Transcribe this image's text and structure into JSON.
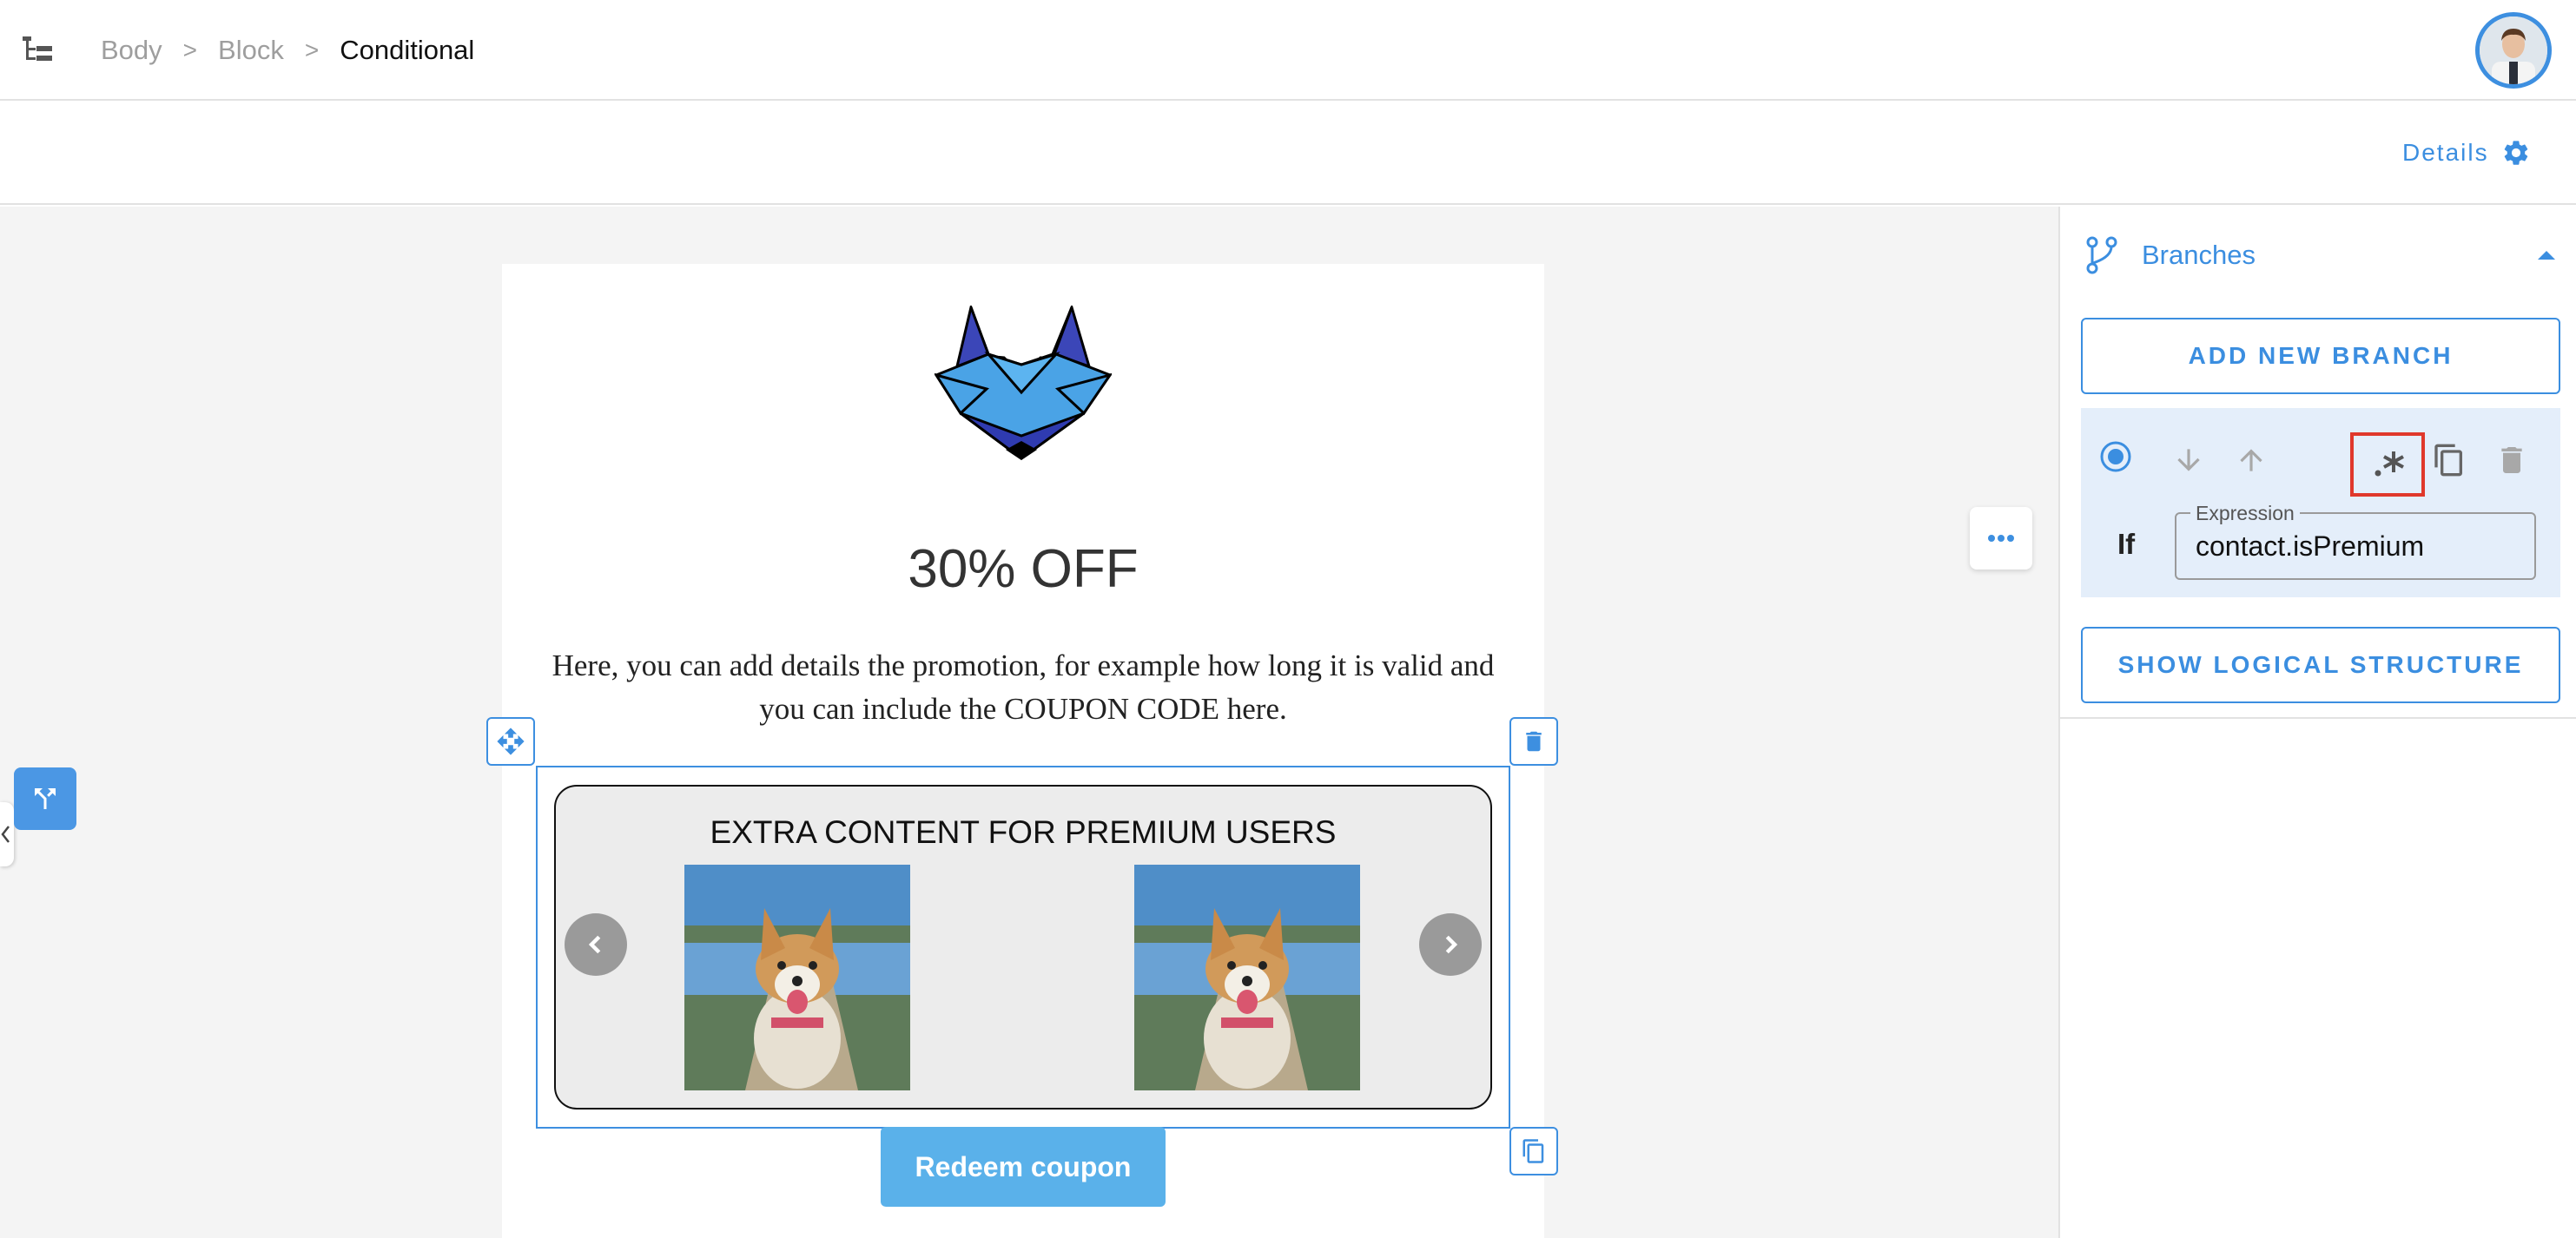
{
  "breadcrumb": {
    "items": [
      "Body",
      "Block"
    ],
    "separator": ">",
    "current": "Conditional"
  },
  "toolbar": {
    "details_label": "Details"
  },
  "email": {
    "headline": "30% OFF",
    "body_text": "Here, you can add details  the promotion, for example how long it is valid and you can include the COUPON CODE here.",
    "carousel_title": "EXTRA CONTENT FOR PREMIUM USERS",
    "redeem_label": "Redeem coupon"
  },
  "panel": {
    "section_title": "Branches",
    "add_branch_label": "ADD NEW BRANCH",
    "branch": {
      "if_label": "If",
      "expression_label": "Expression",
      "expression_value": "contact.isPremium"
    },
    "show_structure_label": "SHOW LOGICAL STRUCTURE"
  },
  "icons": {
    "tree": "tree-icon",
    "gear": "gear-icon",
    "branches": "branch-icon",
    "collapse": "chevron-up-icon",
    "move": "move-icon",
    "delete": "trash-icon",
    "duplicate": "copy-icon",
    "regex": "regex-icon"
  },
  "colors": {
    "accent": "#3b8ee0",
    "button": "#5ab1ea",
    "canvas_bg": "#f4f4f4",
    "branch_card_bg": "#e4eefa",
    "highlight": "#e0382b"
  }
}
